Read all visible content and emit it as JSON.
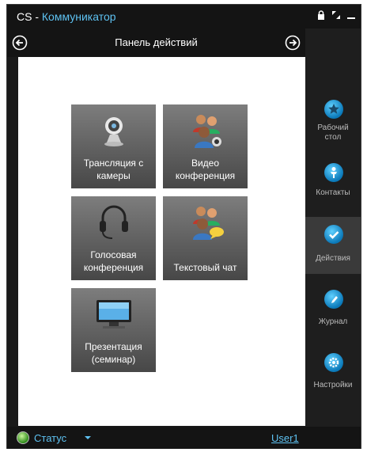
{
  "window": {
    "title_prefix": "CS - ",
    "title_app": "Коммуникатор",
    "controls": [
      "lock-icon",
      "resize-icon",
      "minimize-icon"
    ]
  },
  "nav": {
    "title": "Панель действий",
    "back_icon": "arrow-left-circle-icon",
    "forward_icon": "arrow-right-circle-icon"
  },
  "tiles": [
    {
      "label": "Трансляция с\nкамеры",
      "icon": "webcam-icon"
    },
    {
      "label": "Видео\nконференция",
      "icon": "video-group-icon"
    },
    {
      "label": "Голосовая\nконференция",
      "icon": "headset-icon"
    },
    {
      "label": "Текстовый чат",
      "icon": "chat-group-icon"
    },
    {
      "label": "Презентация\n(семинар)",
      "icon": "monitor-icon"
    }
  ],
  "sidebar": {
    "items": [
      {
        "label": "Рабочий\nстол",
        "icon": "star-icon",
        "active": false
      },
      {
        "label": "Контакты",
        "icon": "person-icon",
        "active": false
      },
      {
        "label": "Действия",
        "icon": "checkmark-icon",
        "active": true
      },
      {
        "label": "Журнал",
        "icon": "pencil-icon",
        "active": false
      },
      {
        "label": "Настройки",
        "icon": "gear-icon",
        "active": false
      }
    ]
  },
  "status": {
    "label": "Статус",
    "user": "User1",
    "indicator_color": "#3aa820"
  },
  "colors": {
    "accent": "#5ec2f2",
    "tile": "#5a5a5a",
    "sidebar_active": "#3a3a3a"
  }
}
